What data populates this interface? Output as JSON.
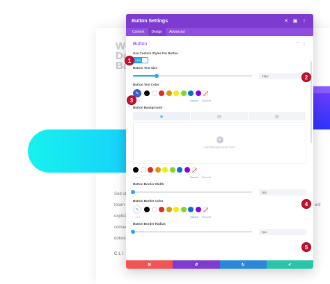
{
  "background": {
    "headline": "Web Des Base",
    "body_lines": [
      "Sed ut",
      "totam",
      "explica",
      "consec",
      "dolore"
    ],
    "right_fragments": [
      "ent"
    ],
    "cta_label": "CLI"
  },
  "modal": {
    "title": "Button Settings",
    "header_icons": [
      "close-icon",
      "split-view-icon",
      "more-icon"
    ],
    "tabs": [
      {
        "label": "Content",
        "active": false
      },
      {
        "label": "Design",
        "active": true
      },
      {
        "label": "Advanced",
        "active": false
      }
    ],
    "group_title": "Button",
    "fields": {
      "use_custom_styles": {
        "label": "Use Custom Styles For Button",
        "value": "YES"
      },
      "text_size": {
        "label": "Button Text Size",
        "value": "18px",
        "fill": 0.2
      },
      "text_color": {
        "label": "Button Text Color"
      },
      "background": {
        "label": "Button Background",
        "add_label": "Add Background Color"
      },
      "border_width": {
        "label": "Button Border Width",
        "value": "0px",
        "fill": 0.0
      },
      "border_color": {
        "label": "Button Border Color"
      },
      "border_radius": {
        "label": "Button Border Radius",
        "value": "0px",
        "fill": 0.0
      }
    },
    "palette": {
      "colors": [
        "#000000",
        "#ffffff",
        "#e02b20",
        "#e09900",
        "#edf000",
        "#7cda24",
        "#0c71c3",
        "#8300e9"
      ],
      "saved_label": "Saved",
      "recent_label": "Recent"
    },
    "footer_buttons": [
      {
        "name": "discard",
        "glyph": "✖",
        "color": "#ef5555"
      },
      {
        "name": "undo",
        "glyph": "↺",
        "color": "#7e3bd0"
      },
      {
        "name": "redo",
        "glyph": "↻",
        "color": "#2b87da"
      },
      {
        "name": "save",
        "glyph": "✔",
        "color": "#29c4a9"
      }
    ],
    "accent": "#7e3bd0"
  },
  "callouts": [
    "1",
    "2",
    "3",
    "4",
    "5"
  ]
}
